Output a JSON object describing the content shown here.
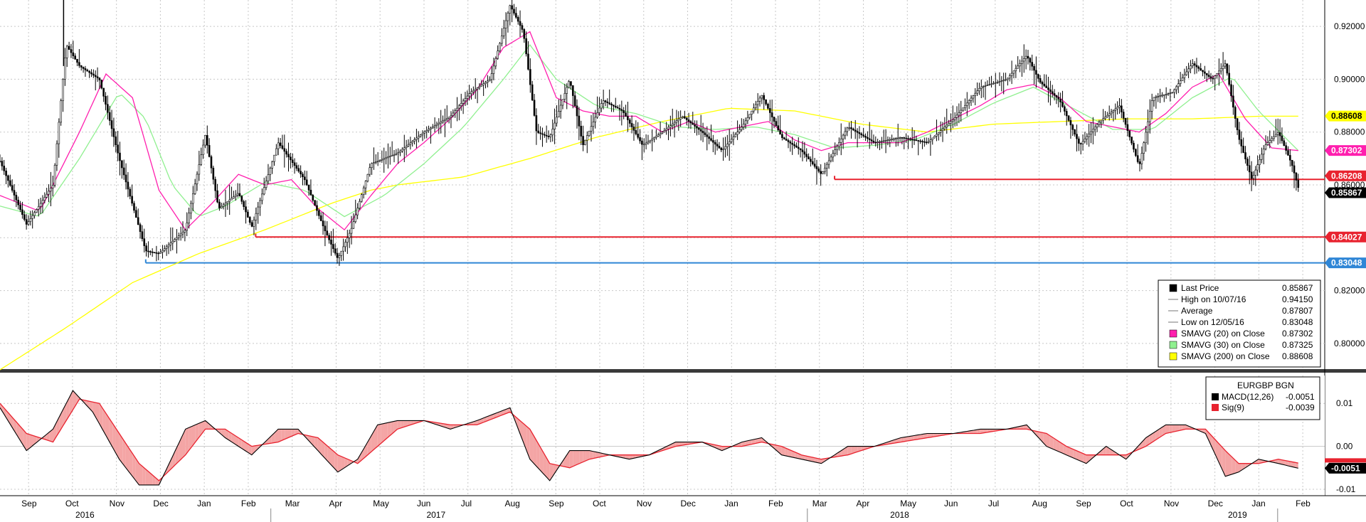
{
  "chart_data": [
    {
      "type": "candlestick",
      "ylim": [
        0.79,
        0.93
      ],
      "y_ticks": [
        "0.92000",
        "0.90000",
        "0.88000",
        "0.86000",
        "0.84000",
        "0.82000",
        "0.80000"
      ],
      "x_months": [
        "Sep",
        "Oct",
        "Nov",
        "Dec",
        "Jan",
        "Feb",
        "Mar",
        "Apr",
        "May",
        "Jun",
        "Jul",
        "Aug",
        "Sep",
        "Oct",
        "Nov",
        "Dec",
        "Jan",
        "Feb",
        "Mar",
        "Apr",
        "May",
        "Jun",
        "Jul",
        "Aug",
        "Sep",
        "Oct",
        "Nov",
        "Dec",
        "Jan",
        "Feb"
      ],
      "x_years": [
        "2016",
        "2017",
        "2018",
        "2019"
      ],
      "price_path": [
        [
          0,
          0.869
        ],
        [
          0.02,
          0.845
        ],
        [
          0.04,
          0.86
        ],
        [
          0.05,
          0.913
        ],
        [
          0.06,
          0.905
        ],
        [
          0.075,
          0.9
        ],
        [
          0.09,
          0.87
        ],
        [
          0.11,
          0.835
        ],
        [
          0.12,
          0.834
        ],
        [
          0.14,
          0.843
        ],
        [
          0.155,
          0.879
        ],
        [
          0.165,
          0.851
        ],
        [
          0.18,
          0.857
        ],
        [
          0.19,
          0.844
        ],
        [
          0.21,
          0.876
        ],
        [
          0.23,
          0.862
        ],
        [
          0.245,
          0.843
        ],
        [
          0.255,
          0.832
        ],
        [
          0.265,
          0.843
        ],
        [
          0.28,
          0.868
        ],
        [
          0.3,
          0.872
        ],
        [
          0.32,
          0.88
        ],
        [
          0.34,
          0.886
        ],
        [
          0.355,
          0.895
        ],
        [
          0.37,
          0.9
        ],
        [
          0.385,
          0.928
        ],
        [
          0.395,
          0.918
        ],
        [
          0.405,
          0.88
        ],
        [
          0.415,
          0.878
        ],
        [
          0.43,
          0.9
        ],
        [
          0.44,
          0.875
        ],
        [
          0.455,
          0.892
        ],
        [
          0.47,
          0.888
        ],
        [
          0.485,
          0.875
        ],
        [
          0.5,
          0.88
        ],
        [
          0.515,
          0.886
        ],
        [
          0.53,
          0.88
        ],
        [
          0.545,
          0.873
        ],
        [
          0.56,
          0.882
        ],
        [
          0.575,
          0.894
        ],
        [
          0.59,
          0.878
        ],
        [
          0.605,
          0.873
        ],
        [
          0.62,
          0.864
        ],
        [
          0.64,
          0.882
        ],
        [
          0.66,
          0.876
        ],
        [
          0.68,
          0.878
        ],
        [
          0.7,
          0.876
        ],
        [
          0.72,
          0.885
        ],
        [
          0.74,
          0.897
        ],
        [
          0.76,
          0.9
        ],
        [
          0.775,
          0.909
        ],
        [
          0.785,
          0.899
        ],
        [
          0.8,
          0.892
        ],
        [
          0.815,
          0.875
        ],
        [
          0.83,
          0.884
        ],
        [
          0.845,
          0.89
        ],
        [
          0.86,
          0.867
        ],
        [
          0.87,
          0.893
        ],
        [
          0.885,
          0.895
        ],
        [
          0.9,
          0.906
        ],
        [
          0.915,
          0.9
        ],
        [
          0.925,
          0.906
        ],
        [
          0.935,
          0.878
        ],
        [
          0.945,
          0.862
        ],
        [
          0.955,
          0.875
        ],
        [
          0.965,
          0.88
        ],
        [
          0.975,
          0.868
        ],
        [
          0.98,
          0.859
        ]
      ],
      "sma20_path": [
        [
          0,
          0.856
        ],
        [
          0.03,
          0.85
        ],
        [
          0.06,
          0.88
        ],
        [
          0.08,
          0.902
        ],
        [
          0.1,
          0.893
        ],
        [
          0.12,
          0.858
        ],
        [
          0.14,
          0.843
        ],
        [
          0.16,
          0.853
        ],
        [
          0.18,
          0.864
        ],
        [
          0.2,
          0.86
        ],
        [
          0.22,
          0.862
        ],
        [
          0.24,
          0.851
        ],
        [
          0.26,
          0.843
        ],
        [
          0.28,
          0.856
        ],
        [
          0.3,
          0.868
        ],
        [
          0.32,
          0.876
        ],
        [
          0.34,
          0.885
        ],
        [
          0.36,
          0.896
        ],
        [
          0.38,
          0.912
        ],
        [
          0.4,
          0.918
        ],
        [
          0.42,
          0.893
        ],
        [
          0.44,
          0.888
        ],
        [
          0.46,
          0.886
        ],
        [
          0.48,
          0.886
        ],
        [
          0.5,
          0.88
        ],
        [
          0.52,
          0.884
        ],
        [
          0.54,
          0.88
        ],
        [
          0.56,
          0.882
        ],
        [
          0.58,
          0.884
        ],
        [
          0.6,
          0.877
        ],
        [
          0.62,
          0.873
        ],
        [
          0.64,
          0.876
        ],
        [
          0.66,
          0.876
        ],
        [
          0.68,
          0.876
        ],
        [
          0.7,
          0.88
        ],
        [
          0.72,
          0.885
        ],
        [
          0.74,
          0.89
        ],
        [
          0.76,
          0.896
        ],
        [
          0.78,
          0.898
        ],
        [
          0.8,
          0.893
        ],
        [
          0.82,
          0.884
        ],
        [
          0.84,
          0.882
        ],
        [
          0.86,
          0.88
        ],
        [
          0.88,
          0.887
        ],
        [
          0.9,
          0.897
        ],
        [
          0.92,
          0.902
        ],
        [
          0.94,
          0.885
        ],
        [
          0.96,
          0.874
        ],
        [
          0.98,
          0.873
        ]
      ],
      "sma30_path": [
        [
          0,
          0.852
        ],
        [
          0.03,
          0.848
        ],
        [
          0.06,
          0.87
        ],
        [
          0.09,
          0.895
        ],
        [
          0.11,
          0.885
        ],
        [
          0.13,
          0.86
        ],
        [
          0.15,
          0.848
        ],
        [
          0.17,
          0.852
        ],
        [
          0.2,
          0.861
        ],
        [
          0.23,
          0.858
        ],
        [
          0.26,
          0.848
        ],
        [
          0.29,
          0.856
        ],
        [
          0.32,
          0.868
        ],
        [
          0.35,
          0.882
        ],
        [
          0.38,
          0.9
        ],
        [
          0.4,
          0.913
        ],
        [
          0.42,
          0.9
        ],
        [
          0.45,
          0.89
        ],
        [
          0.48,
          0.887
        ],
        [
          0.51,
          0.882
        ],
        [
          0.54,
          0.881
        ],
        [
          0.57,
          0.882
        ],
        [
          0.6,
          0.879
        ],
        [
          0.63,
          0.874
        ],
        [
          0.66,
          0.875
        ],
        [
          0.69,
          0.877
        ],
        [
          0.72,
          0.883
        ],
        [
          0.75,
          0.891
        ],
        [
          0.78,
          0.897
        ],
        [
          0.81,
          0.889
        ],
        [
          0.84,
          0.881
        ],
        [
          0.87,
          0.881
        ],
        [
          0.9,
          0.893
        ],
        [
          0.93,
          0.901
        ],
        [
          0.95,
          0.888
        ],
        [
          0.98,
          0.873
        ]
      ],
      "sma200_path": [
        [
          0,
          0.79
        ],
        [
          0.05,
          0.806
        ],
        [
          0.1,
          0.823
        ],
        [
          0.15,
          0.834
        ],
        [
          0.2,
          0.843
        ],
        [
          0.25,
          0.853
        ],
        [
          0.28,
          0.858
        ],
        [
          0.3,
          0.86
        ],
        [
          0.35,
          0.863
        ],
        [
          0.4,
          0.87
        ],
        [
          0.45,
          0.878
        ],
        [
          0.5,
          0.884
        ],
        [
          0.55,
          0.889
        ],
        [
          0.6,
          0.888
        ],
        [
          0.65,
          0.883
        ],
        [
          0.7,
          0.88
        ],
        [
          0.75,
          0.883
        ],
        [
          0.8,
          0.884
        ],
        [
          0.85,
          0.885
        ],
        [
          0.9,
          0.885
        ],
        [
          0.95,
          0.886
        ],
        [
          0.98,
          0.886
        ]
      ],
      "support_lines": [
        {
          "value": 0.86208,
          "from": 0.63,
          "color": "#e8232f"
        },
        {
          "value": 0.84027,
          "from": 0.193,
          "color": "#e8232f"
        },
        {
          "value": 0.83048,
          "from": 0.11,
          "color": "#2f86d6"
        }
      ],
      "right_tags": [
        {
          "label": "0.88608",
          "value": 0.88608,
          "bg": "#ffff00",
          "fg": "#000000"
        },
        {
          "label": "0.87302",
          "value": 0.87302,
          "bg": "#ff1fae",
          "fg": "#ffffff"
        },
        {
          "label": "0.86208",
          "value": 0.86208,
          "bg": "#e8232f",
          "fg": "#ffffff"
        },
        {
          "label": "0.85867",
          "value": 0.85867,
          "bg": "#000000",
          "fg": "#ffffff"
        },
        {
          "label": "0.84027",
          "value": 0.84027,
          "bg": "#e8232f",
          "fg": "#ffffff"
        },
        {
          "label": "0.83048",
          "value": 0.83048,
          "bg": "#2f86d6",
          "fg": "#ffffff"
        }
      ],
      "legend": [
        {
          "swatch": "#000000",
          "label": "Last Price",
          "value": "0.85867"
        },
        {
          "swatch": "none",
          "label": "High on 10/07/16",
          "value": "0.94150"
        },
        {
          "swatch": "none",
          "label": "Average",
          "value": "0.87807"
        },
        {
          "swatch": "none",
          "label": "Low on 12/05/16",
          "value": "0.83048"
        },
        {
          "swatch": "#ff1fae",
          "label": "SMAVG (20)  on Close",
          "value": "0.87302"
        },
        {
          "swatch": "#90f090",
          "label": "SMAVG (30)  on Close",
          "value": "0.87325"
        },
        {
          "swatch": "#ffff00",
          "label": "SMAVG (200)  on Close",
          "value": "0.88608"
        }
      ],
      "colors": {
        "price": "#000000",
        "sma20": "#ff1fae",
        "sma30": "#90f090",
        "sma200": "#ffff00",
        "grid": "#c8c8c8"
      }
    },
    {
      "type": "line",
      "title": "EURGBP BGN",
      "ylim": [
        -0.0115,
        0.0165
      ],
      "y_ticks": [
        "0.01",
        "0.00",
        "-0.01"
      ],
      "macd_path": [
        [
          0,
          0.009
        ],
        [
          0.02,
          -0.001
        ],
        [
          0.04,
          0.004
        ],
        [
          0.055,
          0.013
        ],
        [
          0.07,
          0.008
        ],
        [
          0.09,
          -0.003
        ],
        [
          0.105,
          -0.009
        ],
        [
          0.12,
          -0.009
        ],
        [
          0.14,
          0.004
        ],
        [
          0.155,
          0.006
        ],
        [
          0.17,
          0.002
        ],
        [
          0.19,
          -0.002
        ],
        [
          0.21,
          0.004
        ],
        [
          0.225,
          0.004
        ],
        [
          0.24,
          -0.001
        ],
        [
          0.255,
          -0.006
        ],
        [
          0.27,
          -0.003
        ],
        [
          0.285,
          0.005
        ],
        [
          0.3,
          0.006
        ],
        [
          0.32,
          0.006
        ],
        [
          0.34,
          0.004
        ],
        [
          0.36,
          0.006
        ],
        [
          0.385,
          0.009
        ],
        [
          0.4,
          -0.003
        ],
        [
          0.415,
          -0.008
        ],
        [
          0.43,
          -0.001
        ],
        [
          0.445,
          -0.001
        ],
        [
          0.46,
          -0.002
        ],
        [
          0.475,
          -0.003
        ],
        [
          0.49,
          -0.002
        ],
        [
          0.51,
          0.001
        ],
        [
          0.53,
          0.001
        ],
        [
          0.545,
          -0.001
        ],
        [
          0.56,
          0.001
        ],
        [
          0.575,
          0.002
        ],
        [
          0.59,
          -0.002
        ],
        [
          0.605,
          -0.003
        ],
        [
          0.62,
          -0.004
        ],
        [
          0.64,
          0.0
        ],
        [
          0.66,
          0.0
        ],
        [
          0.68,
          0.002
        ],
        [
          0.7,
          0.003
        ],
        [
          0.72,
          0.003
        ],
        [
          0.74,
          0.004
        ],
        [
          0.76,
          0.004
        ],
        [
          0.775,
          0.005
        ],
        [
          0.79,
          0.0
        ],
        [
          0.805,
          -0.002
        ],
        [
          0.82,
          -0.004
        ],
        [
          0.835,
          0.0
        ],
        [
          0.85,
          -0.003
        ],
        [
          0.865,
          0.002
        ],
        [
          0.88,
          0.005
        ],
        [
          0.895,
          0.005
        ],
        [
          0.91,
          0.003
        ],
        [
          0.925,
          -0.007
        ],
        [
          0.935,
          -0.006
        ],
        [
          0.95,
          -0.003
        ],
        [
          0.965,
          -0.004
        ],
        [
          0.98,
          -0.0051
        ]
      ],
      "sig_path": [
        [
          0,
          0.01
        ],
        [
          0.02,
          0.003
        ],
        [
          0.04,
          0.001
        ],
        [
          0.06,
          0.011
        ],
        [
          0.075,
          0.01
        ],
        [
          0.09,
          0.003
        ],
        [
          0.105,
          -0.004
        ],
        [
          0.12,
          -0.008
        ],
        [
          0.14,
          -0.002
        ],
        [
          0.155,
          0.004
        ],
        [
          0.17,
          0.004
        ],
        [
          0.19,
          0.0
        ],
        [
          0.21,
          0.001
        ],
        [
          0.225,
          0.003
        ],
        [
          0.24,
          0.002
        ],
        [
          0.255,
          -0.002
        ],
        [
          0.27,
          -0.004
        ],
        [
          0.285,
          0.0
        ],
        [
          0.3,
          0.004
        ],
        [
          0.32,
          0.006
        ],
        [
          0.34,
          0.005
        ],
        [
          0.36,
          0.005
        ],
        [
          0.385,
          0.008
        ],
        [
          0.4,
          0.004
        ],
        [
          0.415,
          -0.004
        ],
        [
          0.43,
          -0.005
        ],
        [
          0.445,
          -0.003
        ],
        [
          0.46,
          -0.002
        ],
        [
          0.475,
          -0.002
        ],
        [
          0.49,
          -0.002
        ],
        [
          0.51,
          0.0
        ],
        [
          0.53,
          0.001
        ],
        [
          0.545,
          0.0
        ],
        [
          0.56,
          0.0
        ],
        [
          0.575,
          0.001
        ],
        [
          0.59,
          0.0
        ],
        [
          0.605,
          -0.002
        ],
        [
          0.62,
          -0.003
        ],
        [
          0.64,
          -0.002
        ],
        [
          0.66,
          0.0
        ],
        [
          0.68,
          0.001
        ],
        [
          0.7,
          0.002
        ],
        [
          0.72,
          0.003
        ],
        [
          0.74,
          0.003
        ],
        [
          0.76,
          0.004
        ],
        [
          0.775,
          0.004
        ],
        [
          0.79,
          0.003
        ],
        [
          0.805,
          0.0
        ],
        [
          0.82,
          -0.002
        ],
        [
          0.835,
          -0.002
        ],
        [
          0.85,
          -0.002
        ],
        [
          0.865,
          0.0
        ],
        [
          0.88,
          0.003
        ],
        [
          0.895,
          0.004
        ],
        [
          0.91,
          0.004
        ],
        [
          0.925,
          -0.001
        ],
        [
          0.935,
          -0.004
        ],
        [
          0.95,
          -0.004
        ],
        [
          0.965,
          -0.003
        ],
        [
          0.98,
          -0.0039
        ]
      ],
      "right_tags": [
        {
          "label": "-0.0051",
          "value": -0.0051,
          "bg": "#000000",
          "fg": "#ffffff"
        }
      ],
      "legend": [
        {
          "swatch": "#000000",
          "label": "MACD(12,26)",
          "value": "-0.0051"
        },
        {
          "swatch": "#e8232f",
          "label": "Sig(9)",
          "value": "-0.0039"
        }
      ],
      "colors": {
        "macd": "#000000",
        "sig": "#e8232f",
        "fill": "#f4a5a5"
      }
    }
  ]
}
